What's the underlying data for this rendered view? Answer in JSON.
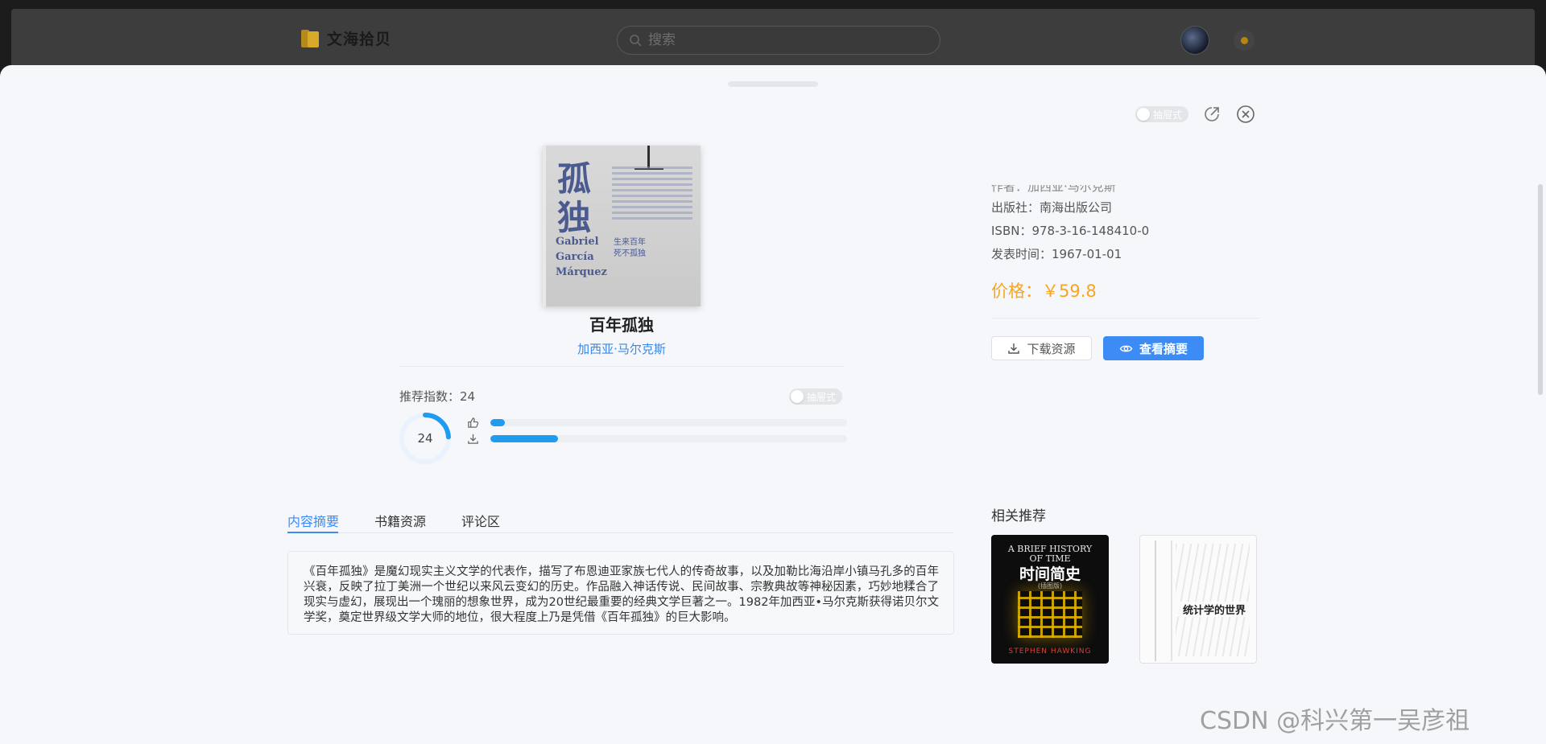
{
  "navbar": {
    "logo_text": "文海拾贝",
    "search_placeholder": "搜索"
  },
  "drawer": {
    "layout_toggle_label": "抽屉式"
  },
  "book": {
    "cover": {
      "title_chars": "孤\n独",
      "author_en": "Gabriel\nGarcía\nMárquez",
      "tagline": "生来百年\n死不孤独"
    },
    "title": "百年孤独",
    "author": "加西亚·马尔克斯",
    "recommend_label": "推荐指数：24",
    "recommend_toggle_label": "抽屉式",
    "recommend_index": 24,
    "like_fraction": 0.04,
    "download_fraction": 0.19
  },
  "info": {
    "author_line_partial": "作者：加西亚·马尔克斯",
    "publisher": "出版社：南海出版公司",
    "isbn": "ISBN：978-3-16-148410-0",
    "publish_date": "发表时间：1967-01-01",
    "price": "价格：￥59.8",
    "download_button": "下载资源",
    "view_button": "查看摘要"
  },
  "tabs": [
    {
      "label": "内容摘要",
      "active": true
    },
    {
      "label": "书籍资源",
      "active": false
    },
    {
      "label": "评论区",
      "active": false
    }
  ],
  "summary_text": "《百年孤独》是魔幻现实主义文学的代表作，描写了布恩迪亚家族七代人的传奇故事，以及加勒比海沿岸小镇马孔多的百年兴衰，反映了拉丁美洲一个世纪以来风云变幻的历史。作品融入神话传说、民间故事、宗教典故等神秘因素，巧妙地糅合了现实与虚幻，展现出一个瑰丽的想象世界，成为20世纪最重要的经典文学巨著之一。1982年加西亚•马尔克斯获得诺贝尔文学奖，奠定世界级文学大师的地位，很大程度上乃是凭借《百年孤独》的巨大影响。",
  "related": {
    "title": "相关推荐",
    "books": [
      {
        "en_title": "A BRIEF HISTORY\nOF TIME",
        "zh_title": "时间简史",
        "edition": "(插图版)",
        "author_en": "STEPHEN HAWKING"
      },
      {
        "zh_title": "统计学的世界"
      }
    ]
  },
  "watermark": "CSDN @科兴第一吴彦祖",
  "colors": {
    "accent": "#3d8bf5",
    "price": "#f5a623",
    "progress": "#1f9bf0",
    "author_link": "#3a87e6"
  }
}
